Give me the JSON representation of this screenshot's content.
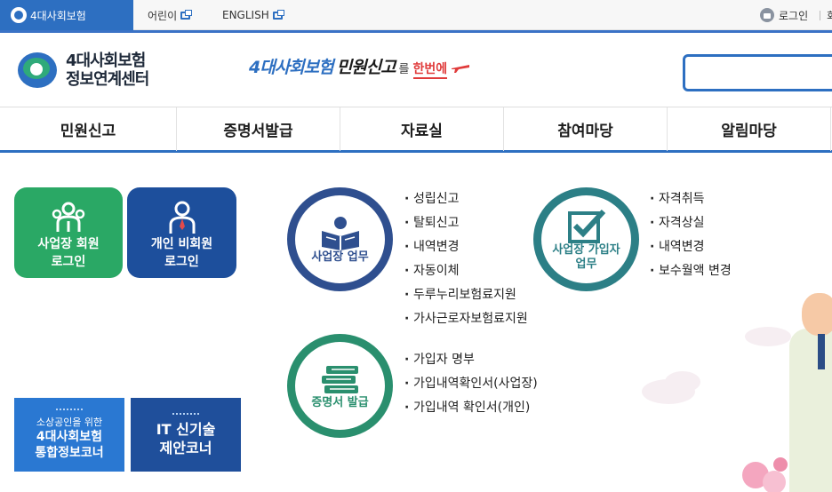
{
  "topbar": {
    "site_tab": "4대사회보험",
    "links": [
      "어린이",
      "ENGLISH"
    ],
    "login": "로그인",
    "trail": "회"
  },
  "header": {
    "brand_line1": "4대사회보험",
    "brand_line2": "정보연계센터",
    "slogan_a": "4대사회보험",
    "slogan_b": "민원신고",
    "slogan_c": "를",
    "slogan_d": "한번에"
  },
  "gnb": [
    "민원신고",
    "증명서발급",
    "자료실",
    "참여마당",
    "알림마당"
  ],
  "tiles": {
    "business_login": [
      "사업장 회원",
      "로그인"
    ],
    "personal_login": [
      "개인 비회원",
      "로그인"
    ]
  },
  "banners": {
    "sme_small": "소상공인을 위한",
    "sme_big1": "4대사회보험",
    "sme_big2": "통합정보코너",
    "it_big1": "IT 신기술",
    "it_big2": "제안코너"
  },
  "sections": {
    "business": {
      "label": "사업장 업무",
      "items": [
        "성립신고",
        "탈퇴신고",
        "내역변경",
        "자동이체",
        "두루누리보험료지원",
        "가사근로자보험료지원"
      ]
    },
    "member": {
      "label1": "사업장 가입자",
      "label2": "업무",
      "items": [
        "자격취득",
        "자격상실",
        "내역변경",
        "보수월액 변경"
      ]
    },
    "certificate": {
      "label": "증명서 발급",
      "items": [
        "가입자 명부",
        "가입내역확인서(사업장)",
        "가입내역 확인서(개인)"
      ]
    }
  },
  "colors": {
    "primary_blue": "#2d6fc1",
    "green_tile": "#2aa865",
    "navy_tile": "#1d4f9c",
    "teal_circle": "#2c7f86",
    "green_circle": "#2a8f6e"
  }
}
